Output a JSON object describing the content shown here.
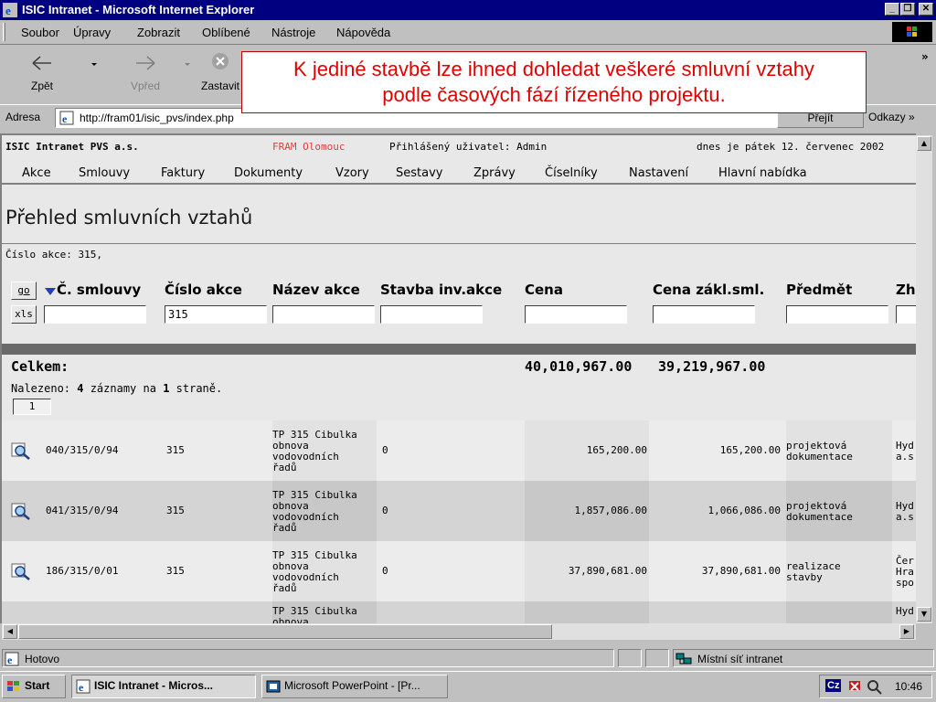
{
  "window": {
    "title": "ISIC Intranet - Microsoft Internet Explorer"
  },
  "menubar": {
    "items": [
      "Soubor",
      "Úpravy",
      "Zobrazit",
      "Oblíbené",
      "Nástroje",
      "Nápověda"
    ]
  },
  "toolbar": {
    "back_label": "Zpět",
    "forward_label": "Vpřed",
    "stop_label": "Zastavit",
    "more_label": "»"
  },
  "addressbar": {
    "label": "Adresa",
    "url": "http://fram01/isic_pvs/index.php",
    "go_label": "Přejít",
    "links_label": "Odkazy »"
  },
  "callout": {
    "line1": "K jediné stavbě lze ihned dohledat veškeré smluvní vztahy",
    "line2": "podle časových fází řízeného projektu."
  },
  "app": {
    "company": "ISIC Intranet PVS a.s.",
    "site": "FRAM Olomouc",
    "user": "Přihlášený uživatel: Admin",
    "date": "dnes je pátek 12. červenec 2002",
    "menu": [
      "Akce",
      "Smlouvy",
      "Faktury",
      "Dokumenty",
      "Vzory",
      "Sestavy",
      "Zprávy",
      "Číselníky",
      "Nastavení",
      "Hlavní nabídka"
    ],
    "page_title": "Přehled smluvních vztahů",
    "action_line": "Číslo akce: 315,",
    "go_button": "go",
    "xls_button": "xls",
    "columns": [
      "Č. smlouvy",
      "Číslo akce",
      "Název akce",
      "Stavba inv.akce",
      "Cena",
      "Cena zákl.sml.",
      "Předmět",
      "Zh"
    ],
    "filters": {
      "cislo_akce": "315"
    },
    "totals": {
      "label": "Celkem:",
      "cena": "40,010,967.00",
      "cena_zakl": "39,219,967.00"
    },
    "found_text": "Nalezeno: 4 záznamy na 1 straně.",
    "found_parts": [
      "Nalezeno: ",
      "4",
      " záznamy na ",
      "1",
      " straně."
    ],
    "page_number": "1",
    "rows": [
      {
        "smlouva": "040/315/0/94",
        "akce": "315",
        "nazev": [
          "TP 315 Cibulka",
          "obnova",
          "vodovodních",
          "řadů"
        ],
        "stavba": "0",
        "cena": "165,200.00",
        "cena_zakl": "165,200.00",
        "predmet": [
          "projektová",
          "dokumentace"
        ],
        "zhotovitel": [
          "Hyd",
          "a.s."
        ]
      },
      {
        "smlouva": "041/315/0/94",
        "akce": "315",
        "nazev": [
          "TP 315 Cibulka",
          "obnova",
          "vodovodních",
          "řadů"
        ],
        "stavba": "0",
        "cena": "1,857,086.00",
        "cena_zakl": "1,066,086.00",
        "predmet": [
          "projektová",
          "dokumentace"
        ],
        "zhotovitel": [
          "Hyd",
          "a.s."
        ]
      },
      {
        "smlouva": "186/315/0/01",
        "akce": "315",
        "nazev": [
          "TP 315 Cibulka",
          "obnova",
          "vodovodních",
          "řadů"
        ],
        "stavba": "0",
        "cena": "37,890,681.00",
        "cena_zakl": "37,890,681.00",
        "predmet": [
          "realizace",
          "stavby"
        ],
        "zhotovitel": [
          "Čer",
          "Hra",
          "spo"
        ]
      },
      {
        "smlouva": "",
        "akce": "",
        "nazev": [
          "TP 315 Cibulka",
          "obnova"
        ],
        "stavba": "",
        "cena": "",
        "cena_zakl": "",
        "predmet": [],
        "zhotovitel": [
          "Hyd"
        ]
      }
    ]
  },
  "statusbar": {
    "text": "Hotovo",
    "zone": "Místní síť intranet"
  },
  "taskbar": {
    "start": "Start",
    "tasks": [
      "ISIC Intranet - Micros...",
      "Microsoft PowerPoint - [Pr..."
    ],
    "lang": "Cz",
    "time": "10:46"
  }
}
